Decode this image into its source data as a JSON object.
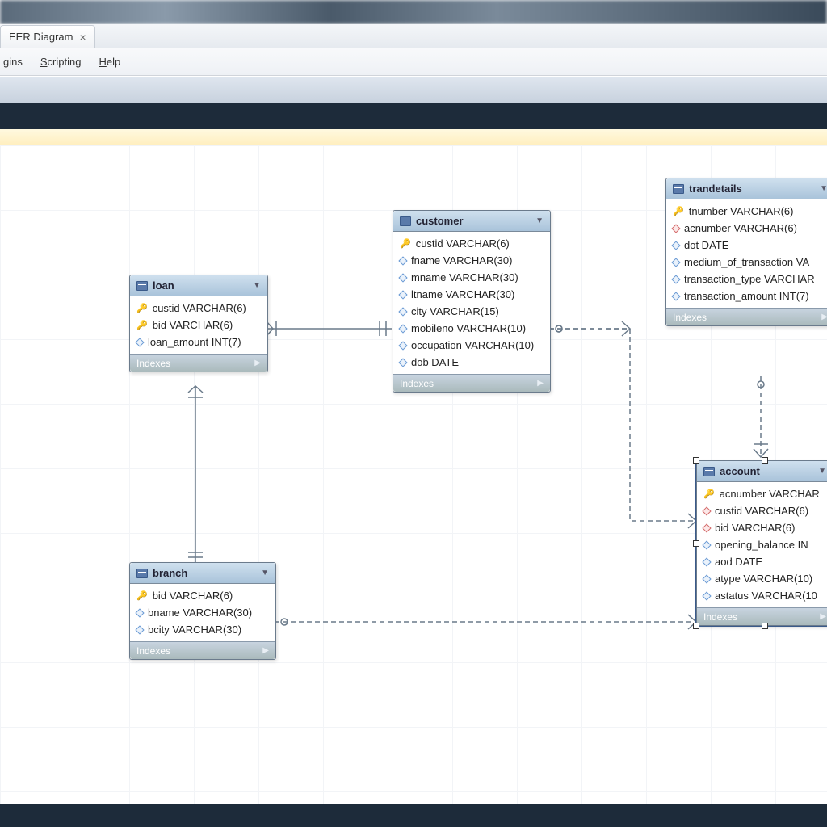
{
  "tab": {
    "title": "EER Diagram"
  },
  "menu": {
    "items": [
      "gins",
      "Scripting",
      "Help"
    ]
  },
  "indexes_label": "Indexes",
  "entities": {
    "loan": {
      "title": "loan",
      "cols": [
        {
          "icon": "key",
          "text": "custid VARCHAR(6)"
        },
        {
          "icon": "key",
          "text": "bid VARCHAR(6)"
        },
        {
          "icon": "diamond",
          "text": "loan_amount INT(7)"
        }
      ]
    },
    "customer": {
      "title": "customer",
      "cols": [
        {
          "icon": "key",
          "text": "custid VARCHAR(6)"
        },
        {
          "icon": "diamond",
          "text": "fname VARCHAR(30)"
        },
        {
          "icon": "diamond",
          "text": "mname VARCHAR(30)"
        },
        {
          "icon": "diamond",
          "text": "ltname VARCHAR(30)"
        },
        {
          "icon": "diamond",
          "text": "city VARCHAR(15)"
        },
        {
          "icon": "diamond",
          "text": "mobileno VARCHAR(10)"
        },
        {
          "icon": "diamond",
          "text": "occupation VARCHAR(10)"
        },
        {
          "icon": "diamond",
          "text": "dob DATE"
        }
      ]
    },
    "trandetails": {
      "title": "trandetails",
      "cols": [
        {
          "icon": "key",
          "text": "tnumber VARCHAR(6)"
        },
        {
          "icon": "reddiamond",
          "text": "acnumber VARCHAR(6)"
        },
        {
          "icon": "diamond",
          "text": "dot DATE"
        },
        {
          "icon": "diamond",
          "text": "medium_of_transaction VA"
        },
        {
          "icon": "diamond",
          "text": "transaction_type VARCHAR"
        },
        {
          "icon": "diamond",
          "text": "transaction_amount INT(7)"
        }
      ]
    },
    "branch": {
      "title": "branch",
      "cols": [
        {
          "icon": "key",
          "text": "bid VARCHAR(6)"
        },
        {
          "icon": "diamond",
          "text": "bname VARCHAR(30)"
        },
        {
          "icon": "diamond",
          "text": "bcity VARCHAR(30)"
        }
      ]
    },
    "account": {
      "title": "account",
      "cols": [
        {
          "icon": "key",
          "text": "acnumber VARCHAR"
        },
        {
          "icon": "reddiamond",
          "text": "custid VARCHAR(6)"
        },
        {
          "icon": "reddiamond",
          "text": "bid VARCHAR(6)"
        },
        {
          "icon": "diamond",
          "text": "opening_balance IN"
        },
        {
          "icon": "diamond",
          "text": "aod DATE"
        },
        {
          "icon": "diamond",
          "text": "atype VARCHAR(10)"
        },
        {
          "icon": "diamond",
          "text": "astatus VARCHAR(10"
        }
      ]
    }
  }
}
